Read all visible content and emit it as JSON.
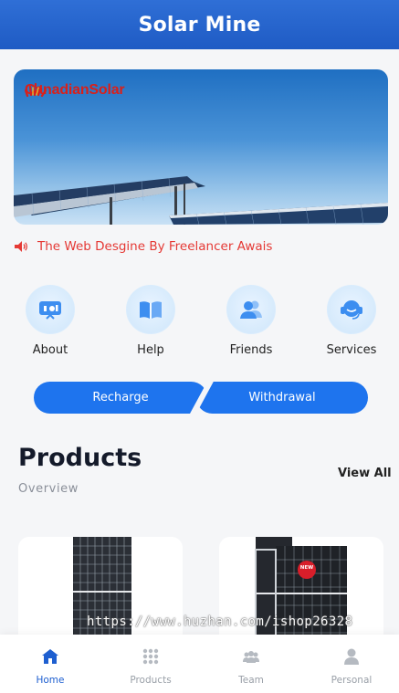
{
  "header": {
    "title": "Solar Mine"
  },
  "banner": {
    "brand": "CanadianSolar"
  },
  "notice": {
    "text": "The Web Desgine By Freelancer Awais"
  },
  "quick_links": [
    {
      "label": "About",
      "icon": "presentation-icon"
    },
    {
      "label": "Help",
      "icon": "book-icon"
    },
    {
      "label": "Friends",
      "icon": "users-icon"
    },
    {
      "label": "Services",
      "icon": "headset-icon"
    }
  ],
  "actions": {
    "recharge": "Recharge",
    "withdraw": "Withdrawal"
  },
  "products": {
    "title": "Products",
    "subtitle": "Overview",
    "view_all": "View All",
    "badge": "NEW"
  },
  "watermark": "https://www.huzhan.com/ishop26328",
  "tabs": [
    {
      "label": "Home",
      "icon": "home-icon",
      "active": true
    },
    {
      "label": "Products",
      "icon": "grid-icon",
      "active": false
    },
    {
      "label": "Team",
      "icon": "team-icon",
      "active": false
    },
    {
      "label": "Personal",
      "icon": "person-icon",
      "active": false
    }
  ],
  "colors": {
    "primary": "#1e74ee",
    "header": "#2466cc",
    "notice": "#e53935",
    "active_tab": "#1e5fd0"
  }
}
